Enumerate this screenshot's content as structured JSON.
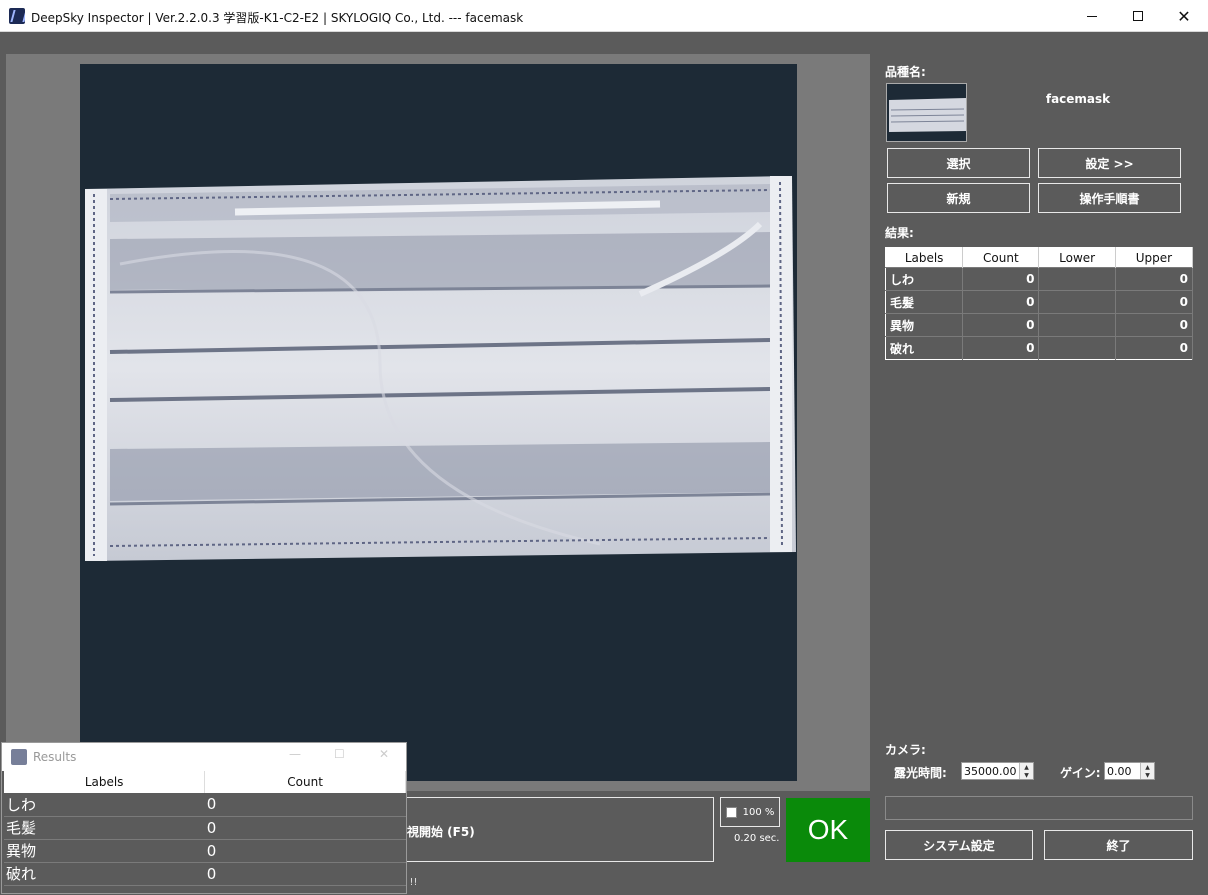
{
  "window": {
    "title": "DeepSky Inspector | Ver.2.2.0.3 学習版-K1-C2-E2 | SKYLOGIQ Co., Ltd. --- facemask",
    "minimize_icon": "minimize-icon",
    "maximize_icon": "maximize-icon",
    "close_icon": "close-icon"
  },
  "product": {
    "label": "品種名:",
    "name": "facemask",
    "select_button": "選択",
    "settings_button": "設定 >>",
    "new_button": "新規",
    "manual_button": "操作手順書"
  },
  "results": {
    "label": "結果:",
    "columns": [
      "Labels",
      "Count",
      "Lower",
      "Upper"
    ],
    "rows": [
      {
        "label": "しわ",
        "count": "0",
        "lower": "",
        "upper": "0"
      },
      {
        "label": "毛髪",
        "count": "0",
        "lower": "",
        "upper": "0"
      },
      {
        "label": "異物",
        "count": "0",
        "lower": "",
        "upper": "0"
      },
      {
        "label": "破れ",
        "count": "0",
        "lower": "",
        "upper": "0"
      }
    ]
  },
  "camera": {
    "label": "カメラ:",
    "exposure_label": "露光時間:",
    "exposure_value": "35000.00",
    "gain_label": "ゲイン:",
    "gain_value": "0.00"
  },
  "bottom": {
    "system_settings_button": "システム設定",
    "exit_button": "終了",
    "monitor_button": "監視開始 (F5)",
    "zoom": "100 %",
    "time": "0.20 sec.",
    "judgement": "OK",
    "status_fragment": "d !!"
  },
  "results_window": {
    "title": "Results",
    "columns": [
      "Labels",
      "Count"
    ],
    "rows": [
      {
        "label": "しわ",
        "count": "0"
      },
      {
        "label": "毛髪",
        "count": "0"
      },
      {
        "label": "異物",
        "count": "0"
      },
      {
        "label": "破れ",
        "count": "0"
      }
    ]
  },
  "colors": {
    "background": "#5b5b5b",
    "ok_green": "#0a8a0a",
    "camera_bg": "#1d2a36"
  }
}
